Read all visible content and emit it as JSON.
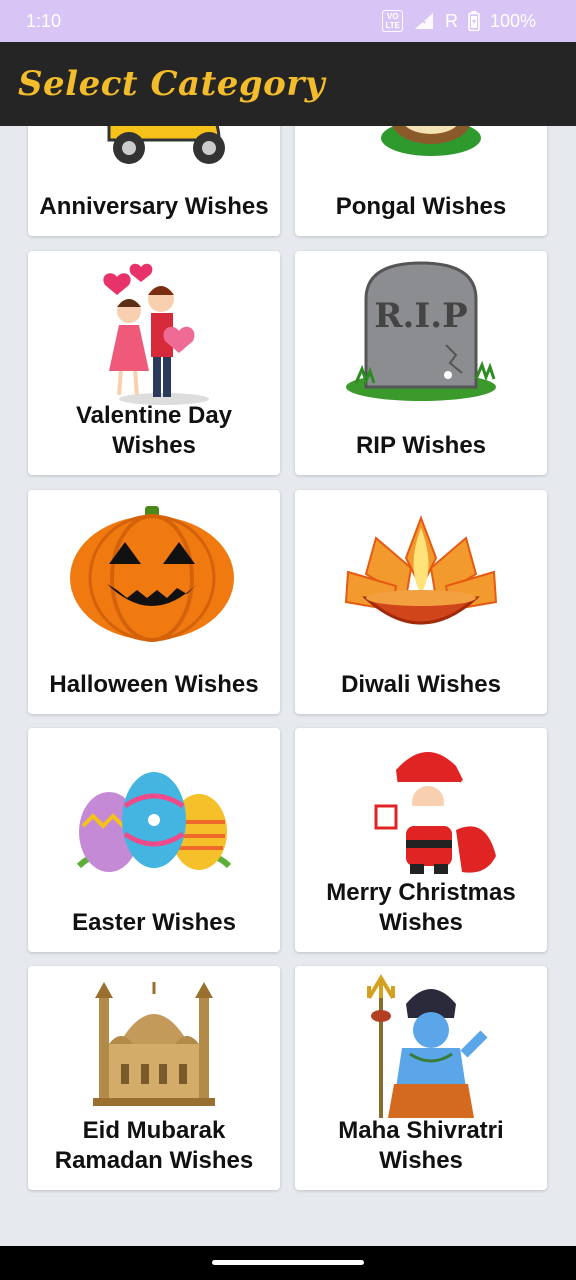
{
  "status": {
    "time": "1:10",
    "volte_line1": "VO",
    "volte_line2": "LTE",
    "roaming": "R",
    "battery": "100%"
  },
  "app_bar": {
    "title": "Select Category"
  },
  "cards": [
    {
      "label": "Anniversary Wishes",
      "icon": "scooter-couple-icon"
    },
    {
      "label": "Pongal Wishes",
      "icon": "pongal-pot-icon"
    },
    {
      "label": "Valentine Day Wishes",
      "icon": "valentine-couple-icon"
    },
    {
      "label": "RIP Wishes",
      "icon": "rip-tombstone-icon"
    },
    {
      "label": "Halloween Wishes",
      "icon": "pumpkin-icon"
    },
    {
      "label": "Diwali Wishes",
      "icon": "diya-lamp-icon"
    },
    {
      "label": "Easter Wishes",
      "icon": "easter-eggs-icon"
    },
    {
      "label": "Merry Christmas Wishes",
      "icon": "santa-icon"
    },
    {
      "label": "Eid Mubarak Ramadan Wishes",
      "icon": "mosque-icon"
    },
    {
      "label": "Maha Shivratri Wishes",
      "icon": "shiva-icon"
    }
  ]
}
